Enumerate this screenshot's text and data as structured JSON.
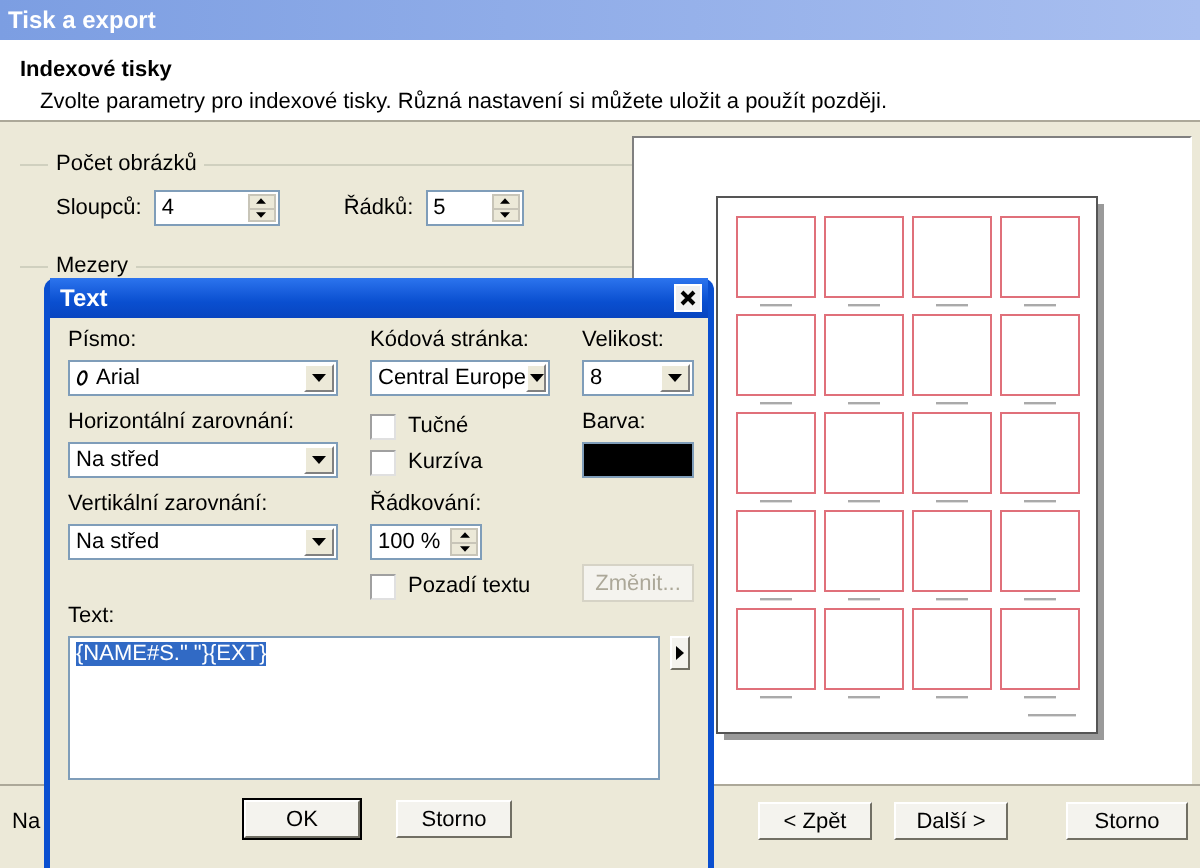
{
  "window": {
    "title": "Tisk a export"
  },
  "header": {
    "title": "Indexové tisky",
    "subtitle": "Zvolte parametry pro indexové tisky. Různá nastavení si můžete uložit a použít později."
  },
  "count_group": {
    "legend": "Počet obrázků",
    "fields": [
      {
        "label": "Sloupců:",
        "value": "4"
      },
      {
        "label": "Řádků:",
        "value": "5"
      }
    ]
  },
  "spacing_group": {
    "legend": "Mezery"
  },
  "footer_text": "Na",
  "buttons": [
    "< Zpět",
    "Další >",
    "Storno"
  ],
  "dialog": {
    "title": "Text",
    "font": {
      "label": "Písmo:",
      "value": "Arial"
    },
    "codepage": {
      "label": "Kódová stránka:",
      "value": "Central Europe"
    },
    "size": {
      "label": "Velikost:",
      "value": "8"
    },
    "h_align": {
      "label": "Horizontální zarovnání:",
      "value": "Na střed"
    },
    "v_align": {
      "label": "Vertikální zarovnání:",
      "value": "Na střed"
    },
    "checkboxes": [
      {
        "label": "Tučné",
        "checked": false
      },
      {
        "label": "Kurzíva",
        "checked": false
      },
      {
        "label": "Pozadí textu",
        "checked": false
      }
    ],
    "color": {
      "label": "Barva:",
      "color": "#000000"
    },
    "line_spacing": {
      "label": "Řádkování:",
      "value": "100 %"
    },
    "change_button": {
      "label": "Změnit...",
      "disabled": true
    },
    "text": {
      "label": "Text:",
      "value": "{NAME#S.\" \"}{EXT}",
      "selected": true
    },
    "buttons": [
      "OK",
      "Storno"
    ]
  }
}
